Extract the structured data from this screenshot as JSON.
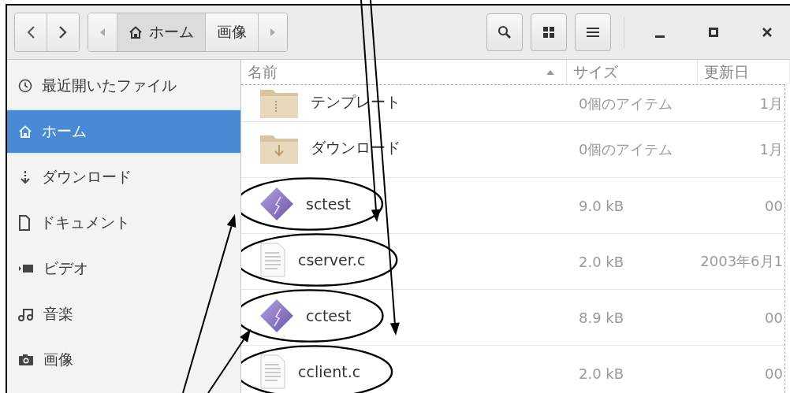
{
  "path_bar": {
    "crumbs": [
      {
        "label": "ホーム",
        "kind": "home",
        "selected": true
      },
      {
        "label": "画像",
        "kind": "folder",
        "selected": false
      }
    ]
  },
  "sidebar": {
    "items": [
      {
        "label": "最近開いたファイル",
        "kind": "recent",
        "selected": false
      },
      {
        "label": "ホーム",
        "kind": "home",
        "selected": true
      },
      {
        "label": "ダウンロード",
        "kind": "download",
        "selected": false
      },
      {
        "label": "ドキュメント",
        "kind": "document",
        "selected": false
      },
      {
        "label": "ビデオ",
        "kind": "video",
        "selected": false
      },
      {
        "label": "音楽",
        "kind": "music",
        "selected": false
      },
      {
        "label": "画像",
        "kind": "picture",
        "selected": false
      }
    ]
  },
  "table": {
    "columns": [
      {
        "label": "名前",
        "sorted": true
      },
      {
        "label": "サイズ",
        "sorted": false
      },
      {
        "label": "更新日",
        "sorted": false
      }
    ],
    "rows": [
      {
        "name": "テンプレート",
        "kind": "folder",
        "size": "0個のアイテム",
        "modified": "1月",
        "circled": false
      },
      {
        "name": "ダウンロード",
        "kind": "download-folder",
        "size": "0個のアイテム",
        "modified": "1月",
        "circled": false
      },
      {
        "name": "sctest",
        "kind": "executable",
        "size": "9.0 kB",
        "modified": "00",
        "circled": true
      },
      {
        "name": "cserver.c",
        "kind": "text",
        "size": "2.0 kB",
        "modified": "2003年6月1",
        "circled": true
      },
      {
        "name": "cctest",
        "kind": "executable",
        "size": "8.9 kB",
        "modified": "00",
        "circled": true
      },
      {
        "name": "cclient.c",
        "kind": "text",
        "size": "2.0 kB",
        "modified": "00",
        "circled": true
      }
    ]
  }
}
